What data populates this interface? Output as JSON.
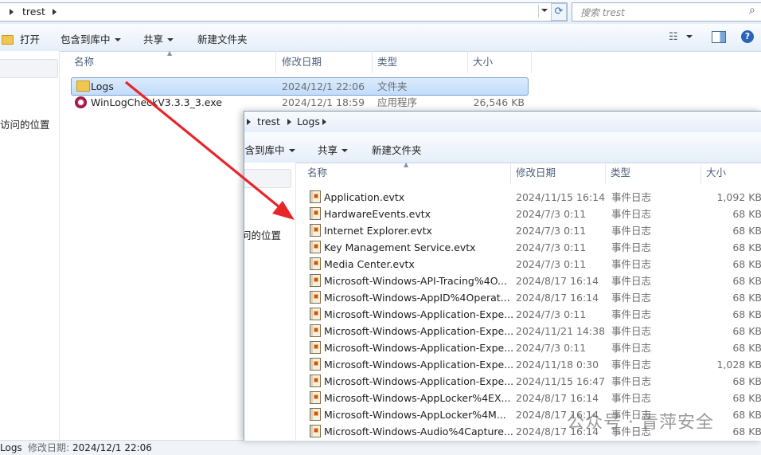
{
  "back_window": {
    "breadcrumb": [
      "trest"
    ],
    "search_placeholder": "搜索 trest",
    "toolbar": {
      "open": "打开",
      "include_library": "包含到库中",
      "share": "共享",
      "new_folder": "新建文件夹"
    },
    "nav_item": "访问的位置",
    "columns": {
      "name": "名称",
      "modified": "修改日期",
      "type": "类型",
      "size": "大小"
    },
    "rows": [
      {
        "name": "Logs",
        "modified": "2024/12/1 22:06",
        "type": "文件夹",
        "size": ""
      },
      {
        "name": "WinLogCheckV3.3.3_3.exe",
        "modified": "2024/12/1 18:59",
        "type": "应用程序",
        "size": "26,546 KB"
      }
    ],
    "status": {
      "name": "Logs",
      "modified_label": "修改日期:",
      "modified_value": "2024/12/1 22:06"
    }
  },
  "front_window": {
    "breadcrumb": [
      "trest",
      "Logs"
    ],
    "toolbar": {
      "include_library": "包含到库中",
      "share": "共享",
      "new_folder": "新建文件夹"
    },
    "nav_item": "问的位置",
    "columns": {
      "name": "名称",
      "modified": "修改日期",
      "type": "类型",
      "size": "大小"
    },
    "rows": [
      {
        "name": "Application.evtx",
        "modified": "2024/11/15 16:14",
        "type": "事件日志",
        "size": "1,092 KB"
      },
      {
        "name": "HardwareEvents.evtx",
        "modified": "2024/7/3 0:11",
        "type": "事件日志",
        "size": "68 KB"
      },
      {
        "name": "Internet Explorer.evtx",
        "modified": "2024/7/3 0:11",
        "type": "事件日志",
        "size": "68 KB"
      },
      {
        "name": "Key Management Service.evtx",
        "modified": "2024/7/3 0:11",
        "type": "事件日志",
        "size": "68 KB"
      },
      {
        "name": "Media Center.evtx",
        "modified": "2024/7/3 0:11",
        "type": "事件日志",
        "size": "68 KB"
      },
      {
        "name": "Microsoft-Windows-API-Tracing%4O...",
        "modified": "2024/8/17 16:14",
        "type": "事件日志",
        "size": "68 KB"
      },
      {
        "name": "Microsoft-Windows-AppID%4Operat...",
        "modified": "2024/8/17 16:14",
        "type": "事件日志",
        "size": "68 KB"
      },
      {
        "name": "Microsoft-Windows-Application-Expe...",
        "modified": "2024/7/3 0:11",
        "type": "事件日志",
        "size": "68 KB"
      },
      {
        "name": "Microsoft-Windows-Application-Expe...",
        "modified": "2024/11/21 14:38",
        "type": "事件日志",
        "size": "68 KB"
      },
      {
        "name": "Microsoft-Windows-Application-Expe...",
        "modified": "2024/7/3 0:11",
        "type": "事件日志",
        "size": "68 KB"
      },
      {
        "name": "Microsoft-Windows-Application-Expe...",
        "modified": "2024/11/18 0:30",
        "type": "事件日志",
        "size": "1,028 KB"
      },
      {
        "name": "Microsoft-Windows-Application-Expe...",
        "modified": "2024/11/15 16:47",
        "type": "事件日志",
        "size": "68 KB"
      },
      {
        "name": "Microsoft-Windows-AppLocker%4EX...",
        "modified": "2024/8/17 16:14",
        "type": "事件日志",
        "size": "68 KB"
      },
      {
        "name": "Microsoft-Windows-AppLocker%4M...",
        "modified": "2024/8/17 16:14",
        "type": "事件日志",
        "size": "68 KB"
      },
      {
        "name": "Microsoft-Windows-Audio%4Capture...",
        "modified": "2024/8/17 16:14",
        "type": "事件日志",
        "size": "68 KB"
      }
    ]
  },
  "watermark": "公众号 · 青萍安全",
  "colors": {
    "arrow": "#e8262a",
    "selection": "#c1dcfc",
    "header_text": "#4c607a"
  }
}
